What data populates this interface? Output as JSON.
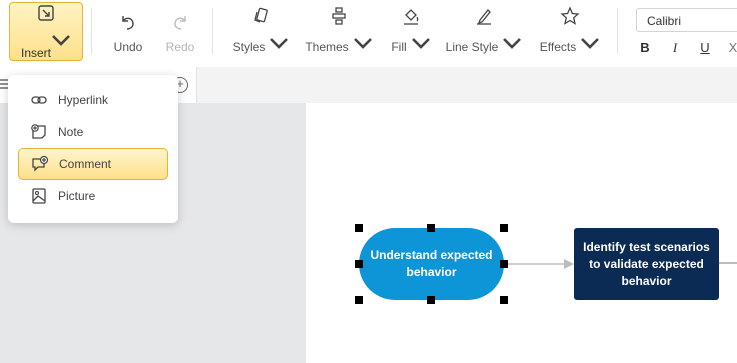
{
  "toolbar": {
    "insert_label": "Insert",
    "undo_label": "Undo",
    "redo_label": "Redo",
    "styles_label": "Styles",
    "themes_label": "Themes",
    "fill_label": "Fill",
    "line_style_label": "Line Style",
    "effects_label": "Effects",
    "font_name": "Calibri",
    "bold_label": "B",
    "italic_label": "I",
    "underline_label": "U",
    "strike_label": "X"
  },
  "insert_menu": {
    "items": [
      {
        "label": "Hyperlink",
        "icon": "link-icon"
      },
      {
        "label": "Note",
        "icon": "note-icon"
      },
      {
        "label": "Comment",
        "icon": "comment-icon",
        "active": true
      },
      {
        "label": "Picture",
        "icon": "picture-icon"
      }
    ]
  },
  "diagram": {
    "node1_text": "Understand expected behavior",
    "node2_text": "Identify test scenarios to validate expected behavior"
  },
  "colors": {
    "accent": "#fde08a",
    "node1": "#0e95d8",
    "node2": "#0b2b55"
  }
}
